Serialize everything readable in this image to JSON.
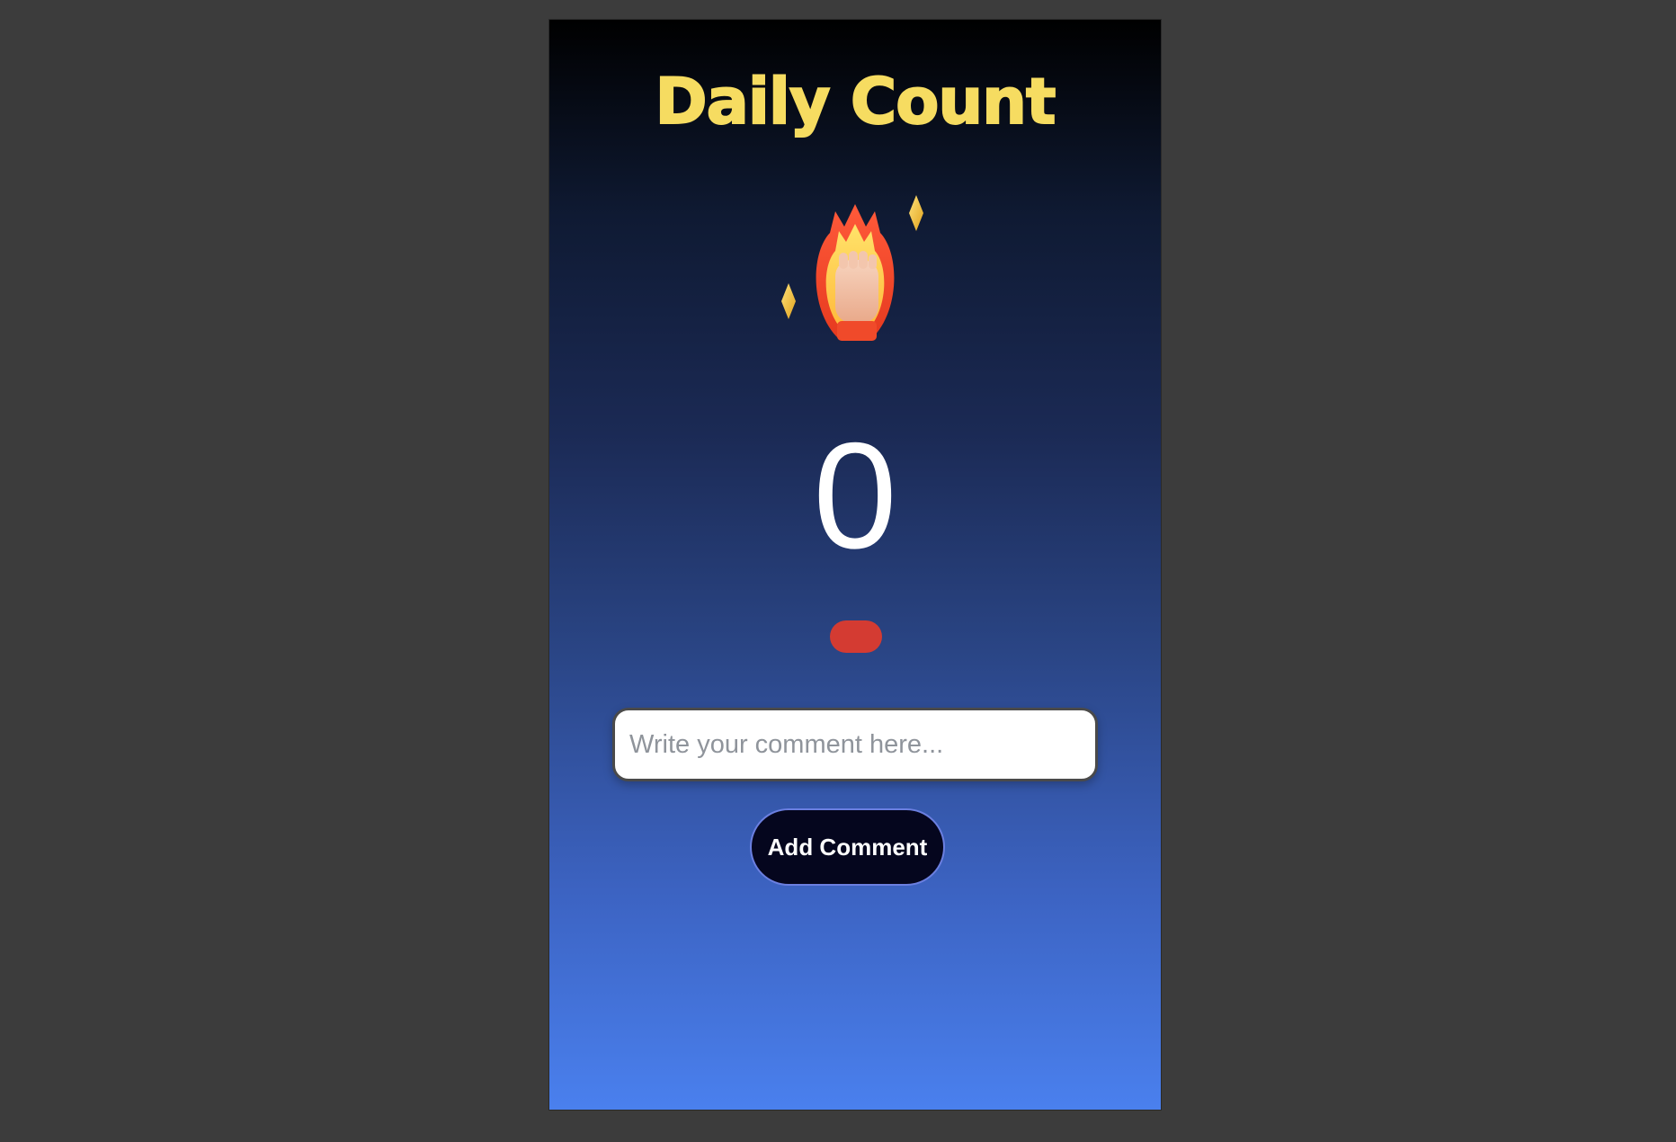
{
  "app": {
    "title": "Daily Count"
  },
  "hero_icon": {
    "name": "fire-fist-icon",
    "sparkles": [
      "sparkle-icon",
      "sparkle-icon"
    ]
  },
  "counter": {
    "value": "0"
  },
  "status_indicator": {
    "color": "#d43b32"
  },
  "comment": {
    "placeholder": "Write your comment here...",
    "value": ""
  },
  "actions": {
    "add_comment_label": "Add Comment"
  },
  "colors": {
    "title": "#f6dc61",
    "gradient_top": "#000000",
    "gradient_bottom": "#4a80ee",
    "button_bg": "#05061e",
    "button_border": "#6b7fe0"
  }
}
